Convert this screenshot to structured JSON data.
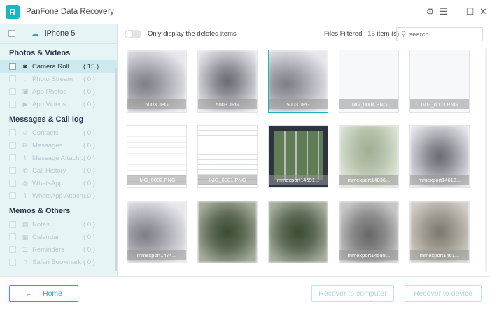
{
  "window": {
    "title": "PanFone Data Recovery",
    "logo_letter": "R"
  },
  "sidebar": {
    "device": "iPhone 5",
    "sections": [
      {
        "title": "Photos & Videos",
        "items": [
          {
            "label": "Camera Roll",
            "count": "( 15 )",
            "active": true
          },
          {
            "label": "Photo Stream",
            "count": "( 0 )"
          },
          {
            "label": "App Photos",
            "count": "( 0 )"
          },
          {
            "label": "App Videos",
            "count": "( 0 )"
          }
        ]
      },
      {
        "title": "Messages & Call log",
        "items": [
          {
            "label": "Contacts",
            "count": "( 0 )"
          },
          {
            "label": "Messages",
            "count": "( 0 )"
          },
          {
            "label": "Message Attach...",
            "count": "( 0 )"
          },
          {
            "label": "Call History",
            "count": "( 0 )"
          },
          {
            "label": "WhatsApp",
            "count": "( 0 )"
          },
          {
            "label": "WhatsApp Attach...",
            "count": "( 0 )"
          }
        ]
      },
      {
        "title": "Memos & Others",
        "items": [
          {
            "label": "Notes",
            "count": "( 0 )"
          },
          {
            "label": "Calendar",
            "count": "( 0 )"
          },
          {
            "label": "Reminders",
            "count": "( 0 )"
          },
          {
            "label": "Safari Bookmark",
            "count": "( 0 )"
          }
        ]
      }
    ]
  },
  "filter": {
    "toggle_label": "Only display the deleted items",
    "files_prefix": "Files Filtered : ",
    "files_count": "15",
    "files_suffix": " item (s)",
    "search_placeholder": "search"
  },
  "thumbnails": [
    {
      "name": "5003.JPG",
      "style": "blur-crowd"
    },
    {
      "name": "5003.JPG",
      "style": "blur-crowd2"
    },
    {
      "name": "5003.JPG",
      "style": "blur-crowd",
      "selected": true
    },
    {
      "name": "IMG_0004.PNG",
      "style": "doc-blank"
    },
    {
      "name": "IMG_0003.PNG",
      "style": "doc-blank"
    },
    {
      "name": "IMG_0002.PNG",
      "style": "doc"
    },
    {
      "name": "IMG_0001.PNG",
      "style": "phone-list"
    },
    {
      "name": "mmexport14691...",
      "style": "phone-grid"
    },
    {
      "name": "mmexport14836...",
      "style": "green"
    },
    {
      "name": "mmexport14613...",
      "style": "blur-crowd2"
    },
    {
      "name": "mmexport1474...",
      "style": "blur-crowd"
    },
    {
      "name": "",
      "style": "dark-green"
    },
    {
      "name": "",
      "style": "dark-green"
    },
    {
      "name": "mmexport14588...",
      "style": "grey-road"
    },
    {
      "name": "mmexport1461...",
      "style": "grey-room"
    }
  ],
  "buttons": {
    "home": "Home",
    "recover_computer": "Recover to computer",
    "recover_device": "Recover to device"
  }
}
